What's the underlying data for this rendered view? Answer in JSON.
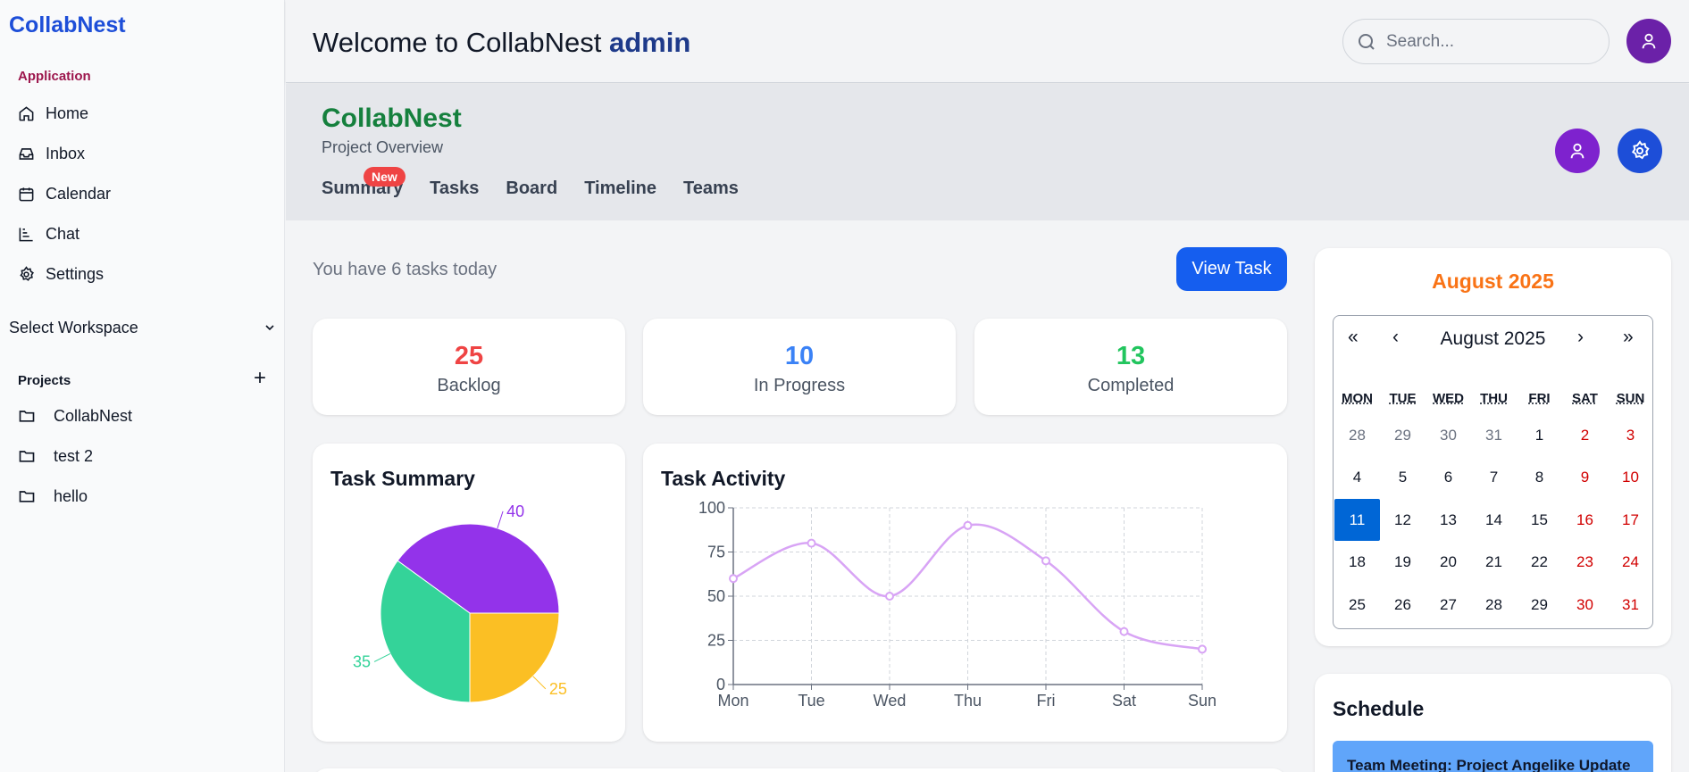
{
  "app": {
    "brand": "CollabNest"
  },
  "sidebar": {
    "section_application": "Application",
    "nav": [
      {
        "label": "Home",
        "icon": "home-icon"
      },
      {
        "label": "Inbox",
        "icon": "inbox-icon"
      },
      {
        "label": "Calendar",
        "icon": "calendar-icon"
      },
      {
        "label": "Chat",
        "icon": "chart-icon"
      },
      {
        "label": "Settings",
        "icon": "gear-icon"
      }
    ],
    "workspace_select": "Select Workspace",
    "section_projects": "Projects",
    "projects": [
      {
        "label": "CollabNest",
        "icon": "folder-icon"
      },
      {
        "label": "test 2",
        "icon": "folder-icon"
      },
      {
        "label": "hello",
        "icon": "folder-icon"
      }
    ]
  },
  "header": {
    "welcome_prefix": "Welcome to CollabNest",
    "user": "admin",
    "search_placeholder": "Search..."
  },
  "project": {
    "title": "CollabNest",
    "subtitle": "Project Overview",
    "tabs": [
      "Summary",
      "Tasks",
      "Board",
      "Timeline",
      "Teams"
    ],
    "tasks_badge": "New"
  },
  "main": {
    "tasks_today": "You have 6 tasks today",
    "view_task_label": "View Task",
    "stats": [
      {
        "value": "25",
        "label": "Backlog",
        "color": "#ef4444"
      },
      {
        "value": "10",
        "label": "In Progress",
        "color": "#3b82f6"
      },
      {
        "value": "13",
        "label": "Completed",
        "color": "#22c55e"
      }
    ]
  },
  "task_summary": {
    "title": "Task Summary"
  },
  "task_activity": {
    "title": "Task Activity"
  },
  "chart_data": [
    {
      "type": "pie",
      "title": "Task Summary",
      "slices": [
        {
          "value": 40,
          "label": "40",
          "color": "#9333ea"
        },
        {
          "value": 25,
          "label": "25",
          "color": "#fbbf24"
        },
        {
          "value": 35,
          "label": "35",
          "color": "#34d399"
        }
      ]
    },
    {
      "type": "line",
      "title": "Task Activity",
      "categories": [
        "Mon",
        "Tue",
        "Wed",
        "Thu",
        "Fri",
        "Sat",
        "Sun"
      ],
      "values": [
        60,
        80,
        50,
        90,
        70,
        30,
        20
      ],
      "ylim": [
        0,
        100
      ],
      "yticks": [
        "0",
        "25",
        "50",
        "75",
        "100"
      ],
      "grid": true,
      "color": "#d8a4f5"
    }
  ],
  "calendar": {
    "heading": "August 2025",
    "month_label": "August 2025",
    "nav": [
      "«",
      "‹",
      "›",
      "»"
    ],
    "dow": [
      "MON",
      "TUE",
      "WED",
      "THU",
      "FRI",
      "SAT",
      "SUN"
    ],
    "weeks": [
      [
        "28",
        "29",
        "30",
        "31",
        "1",
        "2",
        "3"
      ],
      [
        "4",
        "5",
        "6",
        "7",
        "8",
        "9",
        "10"
      ],
      [
        "11",
        "12",
        "13",
        "14",
        "15",
        "16",
        "17"
      ],
      [
        "18",
        "19",
        "20",
        "21",
        "22",
        "23",
        "24"
      ],
      [
        "25",
        "26",
        "27",
        "28",
        "29",
        "30",
        "31"
      ]
    ],
    "today": "11"
  },
  "schedule": {
    "title": "Schedule",
    "items": [
      "Team Meeting: Project Angelike Update"
    ]
  }
}
